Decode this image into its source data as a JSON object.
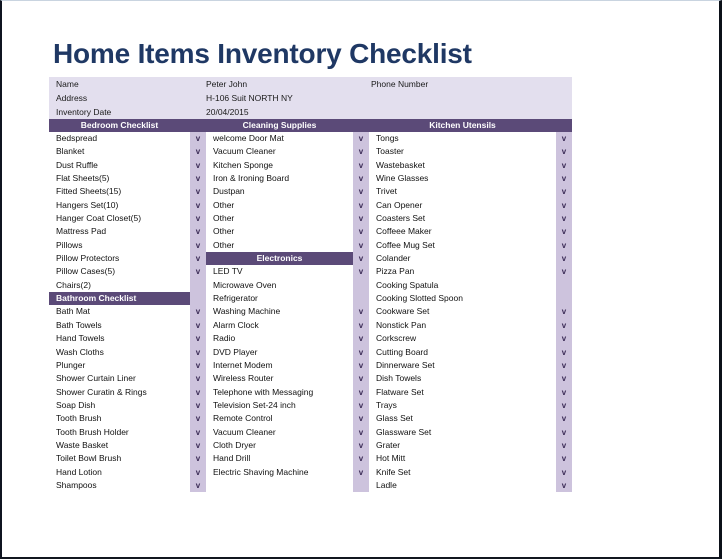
{
  "document": {
    "title": "Home Items Inventory Checklist"
  },
  "colors": {
    "title": "#1f3864",
    "header_band": "#5b4a78",
    "info_background": "#e3dfee",
    "check_column": "#cdc3dd",
    "check_mark": "#3a2a55"
  },
  "info": {
    "rows": [
      {
        "label": "Name",
        "value": "Peter John",
        "extra": "Phone Number"
      },
      {
        "label": "Address",
        "value": "H-106 Suit NORTH NY",
        "extra": ""
      },
      {
        "label": "Inventory Date",
        "value": "20/04/2015",
        "extra": ""
      }
    ]
  },
  "check_glyph": "v",
  "columns": [
    {
      "header": "Bedroom Checklist",
      "rows": [
        {
          "label": "Bedspread",
          "checked": true
        },
        {
          "label": "Blanket",
          "checked": true
        },
        {
          "label": "Dust Ruffle",
          "checked": true
        },
        {
          "label": "Flat Sheets(5)",
          "checked": true
        },
        {
          "label": "Fitted Sheets(15)",
          "checked": true
        },
        {
          "label": "Hangers Set(10)",
          "checked": true
        },
        {
          "label": "Hanger Coat Closet(5)",
          "checked": true
        },
        {
          "label": "Mattress Pad",
          "checked": true
        },
        {
          "label": "Pillows",
          "checked": true
        },
        {
          "label": "Pillow Protectors",
          "checked": true
        },
        {
          "label": "Pillow Cases(5)",
          "checked": true
        },
        {
          "label": "Chairs(2)",
          "checked": false
        },
        {
          "label": "Bathroom Checklist",
          "checked": false,
          "subheader": true
        },
        {
          "label": "Bath Mat",
          "checked": true
        },
        {
          "label": "Bath Towels",
          "checked": true
        },
        {
          "label": "Hand Towels",
          "checked": true
        },
        {
          "label": "Wash Cloths",
          "checked": true
        },
        {
          "label": "Plunger",
          "checked": true
        },
        {
          "label": "Shower Curtain Liner",
          "checked": true
        },
        {
          "label": "Shower Curatin & Rings",
          "checked": true
        },
        {
          "label": "Soap Dish",
          "checked": true
        },
        {
          "label": "Tooth Brush",
          "checked": true
        },
        {
          "label": "Tooth Brush Holder",
          "checked": true
        },
        {
          "label": "Waste Basket",
          "checked": true
        },
        {
          "label": "Toilet Bowl Brush",
          "checked": true
        },
        {
          "label": "Hand Lotion",
          "checked": true
        },
        {
          "label": "Shampoos",
          "checked": true
        }
      ]
    },
    {
      "header": "Cleaning Supplies",
      "rows": [
        {
          "label": "welcome Door Mat",
          "checked": true
        },
        {
          "label": "Vacuum Cleaner",
          "checked": true
        },
        {
          "label": "Kitchen Sponge",
          "checked": true
        },
        {
          "label": "Iron & Ironing Board",
          "checked": true
        },
        {
          "label": "Dustpan",
          "checked": true
        },
        {
          "label": "Other",
          "checked": true
        },
        {
          "label": "Other",
          "checked": true
        },
        {
          "label": "Other",
          "checked": true
        },
        {
          "label": "Other",
          "checked": true
        },
        {
          "label": "Electronics",
          "checked": true,
          "subheader": true
        },
        {
          "label": "LED TV",
          "checked": true
        },
        {
          "label": "Microwave Oven",
          "checked": false
        },
        {
          "label": "Refrigerator",
          "checked": false
        },
        {
          "label": "Washing Machine",
          "checked": true
        },
        {
          "label": "Alarm Clock",
          "checked": true
        },
        {
          "label": "Radio",
          "checked": true
        },
        {
          "label": "DVD Player",
          "checked": true
        },
        {
          "label": "Internet Modem",
          "checked": true
        },
        {
          "label": "Wireless Router",
          "checked": true
        },
        {
          "label": "Telephone with Messaging",
          "checked": true
        },
        {
          "label": "Television Set-24 inch",
          "checked": true
        },
        {
          "label": "Remote Control",
          "checked": true
        },
        {
          "label": "Vacuum Cleaner",
          "checked": true
        },
        {
          "label": "Cloth Dryer",
          "checked": true
        },
        {
          "label": "Hand Drill",
          "checked": true
        },
        {
          "label": "Electric Shaving Machine",
          "checked": true
        },
        {
          "label": "",
          "checked": false
        }
      ]
    },
    {
      "header": "Kitchen Utensils",
      "rows": [
        {
          "label": "Tongs",
          "checked": true
        },
        {
          "label": "Toaster",
          "checked": true
        },
        {
          "label": "Wastebasket",
          "checked": true
        },
        {
          "label": "Wine Glasses",
          "checked": true
        },
        {
          "label": "Trivet",
          "checked": true
        },
        {
          "label": "Can Opener",
          "checked": true
        },
        {
          "label": "Coasters Set",
          "checked": true
        },
        {
          "label": "Coffeee Maker",
          "checked": true
        },
        {
          "label": "Coffee Mug Set",
          "checked": true
        },
        {
          "label": "Colander",
          "checked": true
        },
        {
          "label": "Pizza Pan",
          "checked": true
        },
        {
          "label": "Cooking Spatula",
          "checked": false
        },
        {
          "label": "Cooking Slotted Spoon",
          "checked": false
        },
        {
          "label": "Cookware Set",
          "checked": true
        },
        {
          "label": "Nonstick Pan",
          "checked": true
        },
        {
          "label": "Corkscrew",
          "checked": true
        },
        {
          "label": "Cutting Board",
          "checked": true
        },
        {
          "label": "Dinnerware Set",
          "checked": true
        },
        {
          "label": "Dish Towels",
          "checked": true
        },
        {
          "label": "Flatware Set",
          "checked": true
        },
        {
          "label": "Trays",
          "checked": true
        },
        {
          "label": "Glass Set",
          "checked": true
        },
        {
          "label": "Glassware Set",
          "checked": true
        },
        {
          "label": "Grater",
          "checked": true
        },
        {
          "label": "Hot Mitt",
          "checked": true
        },
        {
          "label": "Knife Set",
          "checked": true
        },
        {
          "label": "Ladle",
          "checked": true
        }
      ]
    }
  ]
}
